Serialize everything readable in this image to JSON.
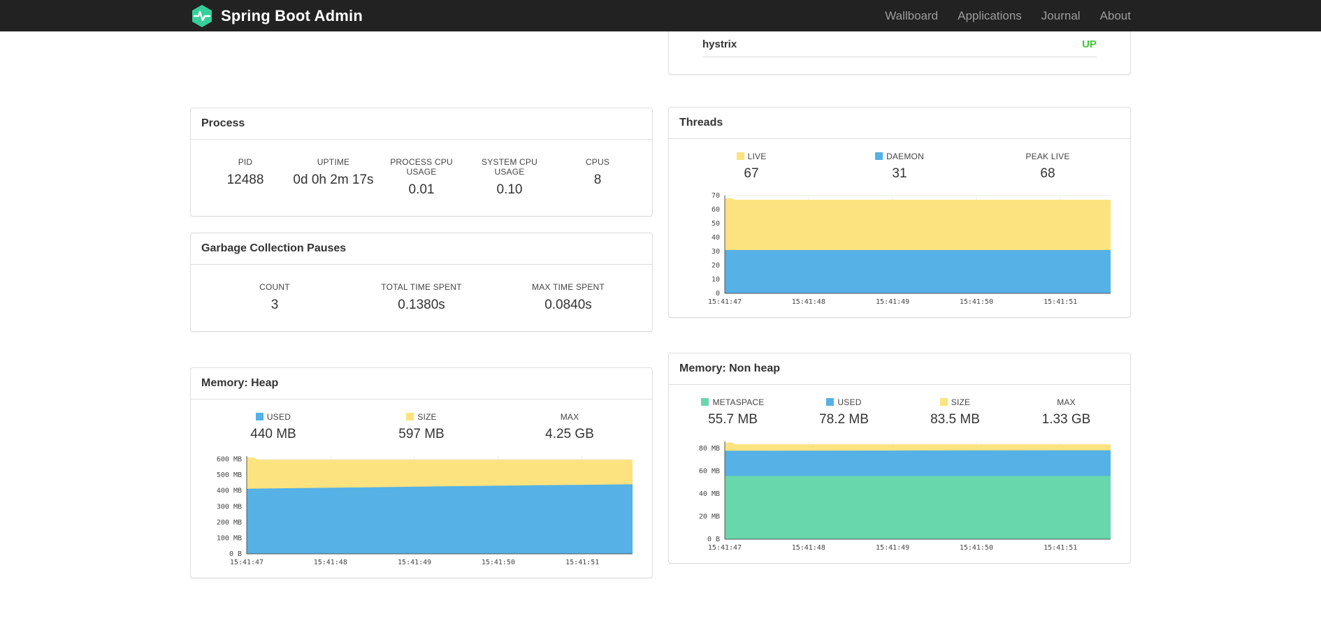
{
  "navbar": {
    "brand": "Spring Boot Admin",
    "links": [
      "Wallboard",
      "Applications",
      "Journal",
      "About"
    ]
  },
  "status_panel": {
    "application": "hystrix",
    "status": "UP",
    "status_color": "#44c636"
  },
  "process": {
    "title": "Process",
    "metrics": [
      {
        "label": "PID",
        "value": "12488"
      },
      {
        "label": "UPTIME",
        "value": "0d 0h 2m 17s"
      },
      {
        "label": "PROCESS CPU USAGE",
        "value": "0.01"
      },
      {
        "label": "SYSTEM CPU USAGE",
        "value": "0.10"
      },
      {
        "label": "CPUS",
        "value": "8"
      }
    ]
  },
  "gc": {
    "title": "Garbage Collection Pauses",
    "metrics": [
      {
        "label": "COUNT",
        "value": "3"
      },
      {
        "label": "TOTAL TIME SPENT",
        "value": "0.1380s"
      },
      {
        "label": "MAX TIME SPENT",
        "value": "0.0840s"
      }
    ]
  },
  "threads": {
    "title": "Threads",
    "legend": [
      {
        "label": "LIVE",
        "value": "67",
        "color": "#fce37f"
      },
      {
        "label": "DAEMON",
        "value": "31",
        "color": "#55b1e6"
      },
      {
        "label": "PEAK LIVE",
        "value": "68",
        "color": ""
      }
    ]
  },
  "heap": {
    "title": "Memory: Heap",
    "legend": [
      {
        "label": "USED",
        "value": "440 MB",
        "color": "#55b1e6"
      },
      {
        "label": "SIZE",
        "value": "597 MB",
        "color": "#fce37f"
      },
      {
        "label": "MAX",
        "value": "4.25 GB",
        "color": ""
      }
    ]
  },
  "nonheap": {
    "title": "Memory: Non heap",
    "legend": [
      {
        "label": "METASPACE",
        "value": "55.7 MB",
        "color": "#68d7ab"
      },
      {
        "label": "USED",
        "value": "78.2 MB",
        "color": "#55b1e6"
      },
      {
        "label": "SIZE",
        "value": "83.5 MB",
        "color": ""
      },
      {
        "label": "MAX",
        "value": "1.33 GB",
        "color": ""
      }
    ]
  },
  "brand_color": "#36cf9a",
  "chart_data": [
    {
      "id": "threads-chart",
      "type": "area",
      "title": "Threads",
      "x_ticks": [
        "15:41:47",
        "15:41:48",
        "15:41:49",
        "15:41:50",
        "15:41:51"
      ],
      "x_tick_fractions": [
        0,
        0.217,
        0.435,
        0.652,
        0.87
      ],
      "y_ticks": [
        {
          "label": "0",
          "value": 0
        },
        {
          "label": "10",
          "value": 10
        },
        {
          "label": "20",
          "value": 20
        },
        {
          "label": "30",
          "value": 30
        },
        {
          "label": "40",
          "value": 40
        },
        {
          "label": "50",
          "value": 50
        },
        {
          "label": "60",
          "value": 60
        },
        {
          "label": "70",
          "value": 70
        }
      ],
      "y_max": 70,
      "series": [
        {
          "name": "LIVE",
          "color": "#fce37f",
          "points": [
            [
              0,
              68
            ],
            [
              0.018,
              68
            ],
            [
              0.028,
              67
            ],
            [
              1,
              67
            ]
          ]
        },
        {
          "name": "DAEMON",
          "color": "#55b1e6",
          "points": [
            [
              0,
              31
            ],
            [
              1,
              31
            ]
          ]
        }
      ]
    },
    {
      "id": "heap-chart",
      "type": "area",
      "title": "Memory: Heap",
      "x_ticks": [
        "15:41:47",
        "15:41:48",
        "15:41:49",
        "15:41:50",
        "15:41:51"
      ],
      "x_tick_fractions": [
        0,
        0.217,
        0.435,
        0.652,
        0.87
      ],
      "y_ticks": [
        {
          "label": "0 B",
          "value": 0
        },
        {
          "label": "100 MB",
          "value": 100
        },
        {
          "label": "200 MB",
          "value": 200
        },
        {
          "label": "300 MB",
          "value": 300
        },
        {
          "label": "400 MB",
          "value": 400
        },
        {
          "label": "500 MB",
          "value": 500
        },
        {
          "label": "600 MB",
          "value": 600
        }
      ],
      "y_max": 620,
      "series": [
        {
          "name": "SIZE",
          "color": "#fce37f",
          "points": [
            [
              0,
              611
            ],
            [
              0.018,
              611
            ],
            [
              0.028,
              597
            ],
            [
              1,
              597
            ]
          ]
        },
        {
          "name": "USED",
          "color": "#55b1e6",
          "points": [
            [
              0,
              413
            ],
            [
              0.25,
              420
            ],
            [
              0.5,
              428
            ],
            [
              0.75,
              435
            ],
            [
              1,
              441
            ]
          ]
        }
      ]
    },
    {
      "id": "nonheap-chart",
      "type": "area",
      "title": "Memory: Non heap",
      "x_ticks": [
        "15:41:47",
        "15:41:48",
        "15:41:49",
        "15:41:50",
        "15:41:51"
      ],
      "x_tick_fractions": [
        0,
        0.217,
        0.435,
        0.652,
        0.87
      ],
      "y_ticks": [
        {
          "label": "0 B",
          "value": 0
        },
        {
          "label": "20 MB",
          "value": 20
        },
        {
          "label": "40 MB",
          "value": 40
        },
        {
          "label": "60 MB",
          "value": 60
        },
        {
          "label": "80 MB",
          "value": 80
        }
      ],
      "y_max": 86,
      "series": [
        {
          "name": "SIZE",
          "color": "#fce37f",
          "points": [
            [
              0,
              85
            ],
            [
              0.018,
              85
            ],
            [
              0.028,
              83.5
            ],
            [
              1,
              83.5
            ]
          ]
        },
        {
          "name": "USED",
          "color": "#55b1e6",
          "points": [
            [
              0,
              77.8
            ],
            [
              0.5,
              78
            ],
            [
              1,
              78.2
            ]
          ]
        },
        {
          "name": "METASPACE",
          "color": "#68d7ab",
          "points": [
            [
              0,
              55.7
            ],
            [
              1,
              55.7
            ]
          ]
        }
      ]
    }
  ]
}
